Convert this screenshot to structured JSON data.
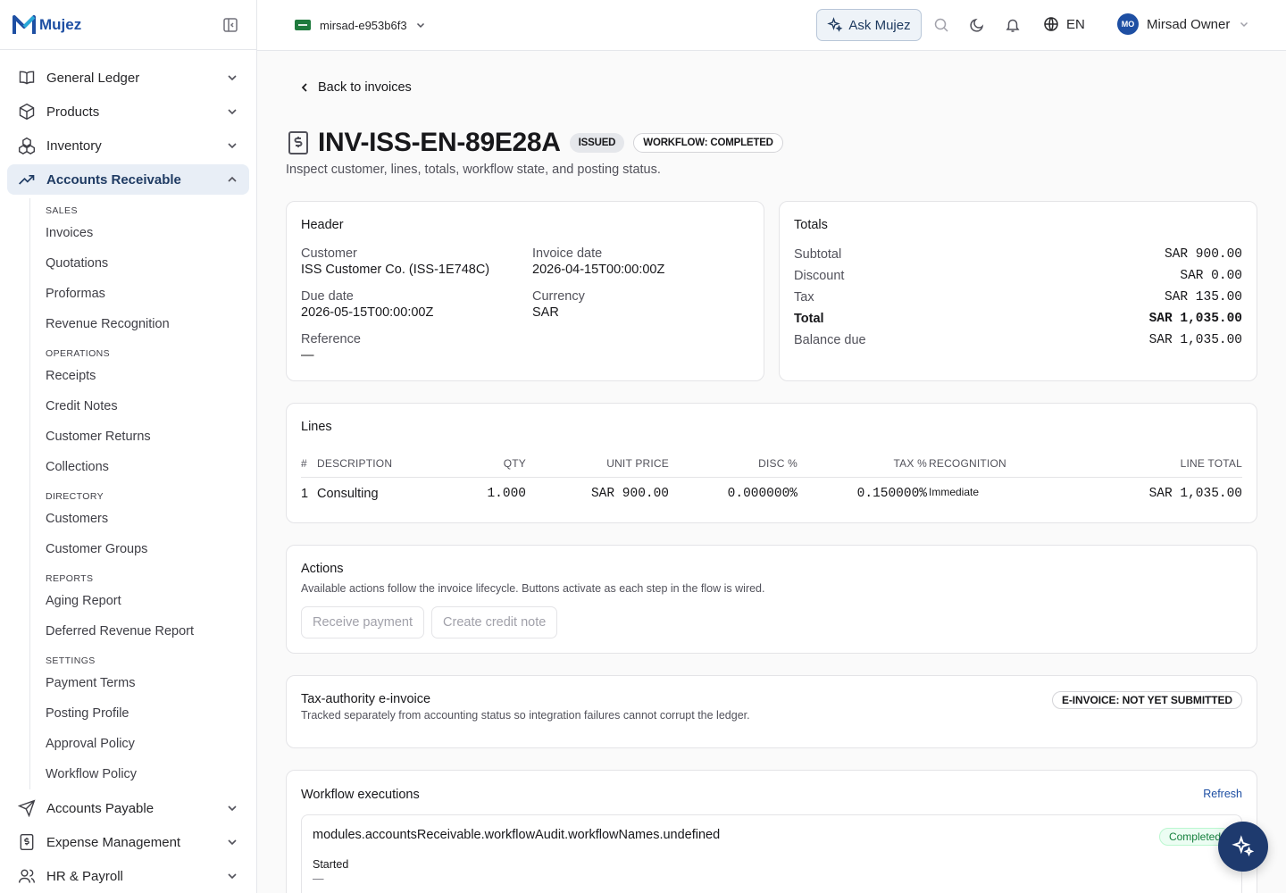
{
  "brand": {
    "name": "Mujez"
  },
  "sidebar": {
    "top_items": [
      {
        "label": "General Ledger",
        "icon": "book-icon"
      },
      {
        "label": "Products",
        "icon": "box-icon"
      },
      {
        "label": "Inventory",
        "icon": "boxes-icon"
      },
      {
        "label": "Accounts Receivable",
        "icon": "trending-up-icon",
        "active": true
      }
    ],
    "ar_sections": {
      "sales": {
        "title": "SALES",
        "items": [
          "Invoices",
          "Quotations",
          "Proformas",
          "Revenue Recognition"
        ]
      },
      "operations": {
        "title": "OPERATIONS",
        "items": [
          "Receipts",
          "Credit Notes",
          "Customer Returns",
          "Collections"
        ]
      },
      "directory": {
        "title": "DIRECTORY",
        "items": [
          "Customers",
          "Customer Groups"
        ]
      },
      "reports": {
        "title": "REPORTS",
        "items": [
          "Aging Report",
          "Deferred Revenue Report"
        ]
      },
      "settings": {
        "title": "SETTINGS",
        "items": [
          "Payment Terms",
          "Posting Profile",
          "Approval Policy",
          "Workflow Policy"
        ]
      }
    },
    "bottom_items": [
      {
        "label": "Accounts Payable",
        "icon": "send-icon"
      },
      {
        "label": "Expense Management",
        "icon": "receipt-icon"
      },
      {
        "label": "HR & Payroll",
        "icon": "users-icon"
      }
    ]
  },
  "topbar": {
    "tenant": "mirsad-e953b6f3",
    "ask_label": "Ask Mujez",
    "language": "EN",
    "user_initials": "MO",
    "user_name": "Mirsad Owner"
  },
  "page": {
    "back_label": "Back to invoices",
    "title": "INV-ISS-EN-89E28A",
    "status_badge": "ISSUED",
    "workflow_badge": "WORKFLOW: COMPLETED",
    "subtitle": "Inspect customer, lines, totals, workflow state, and posting status."
  },
  "header_card": {
    "title": "Header",
    "customer_label": "Customer",
    "customer_value": "ISS Customer Co. (ISS-1E748C)",
    "invoice_date_label": "Invoice date",
    "invoice_date_value": "2026-04-15T00:00:00Z",
    "due_date_label": "Due date",
    "due_date_value": "2026-05-15T00:00:00Z",
    "currency_label": "Currency",
    "currency_value": "SAR",
    "reference_label": "Reference",
    "reference_value": "—"
  },
  "totals_card": {
    "title": "Totals",
    "rows": [
      {
        "label": "Subtotal",
        "value": "SAR 900.00"
      },
      {
        "label": "Discount",
        "value": "SAR 0.00"
      },
      {
        "label": "Tax",
        "value": "SAR 135.00"
      },
      {
        "label": "Total",
        "value": "SAR 1,035.00"
      },
      {
        "label": "Balance due",
        "value": "SAR 1,035.00"
      }
    ]
  },
  "lines_card": {
    "title": "Lines",
    "columns": [
      "#",
      "DESCRIPTION",
      "QTY",
      "UNIT PRICE",
      "DISC %",
      "TAX %",
      "RECOGNITION",
      "LINE TOTAL"
    ],
    "rows": [
      {
        "num": "1",
        "description": "Consulting",
        "qty": "1.000",
        "unit_price": "SAR 900.00",
        "disc": "0.000000%",
        "tax": "0.150000%",
        "recognition": "Immediate",
        "line_total": "SAR 1,035.00"
      }
    ]
  },
  "actions_card": {
    "title": "Actions",
    "description": "Available actions follow the invoice lifecycle. Buttons activate as each step in the flow is wired.",
    "receive_payment": "Receive payment",
    "create_credit_note": "Create credit note"
  },
  "einvoice_card": {
    "title": "Tax-authority e-invoice",
    "description": "Tracked separately from accounting status so integration failures cannot corrupt the ledger.",
    "badge": "E-INVOICE: NOT YET SUBMITTED"
  },
  "workflow_card": {
    "title": "Workflow executions",
    "refresh_label": "Refresh",
    "execution_name": "modules.accountsReceivable.workflowAudit.workflowNames.undefined",
    "status": "Completed",
    "started_label": "Started",
    "started_value": "—"
  },
  "colors": {
    "brand": "#1e4fa3",
    "active_bg": "#e8eef6",
    "fab": "#1e3a6e",
    "completed": "#15803d"
  }
}
